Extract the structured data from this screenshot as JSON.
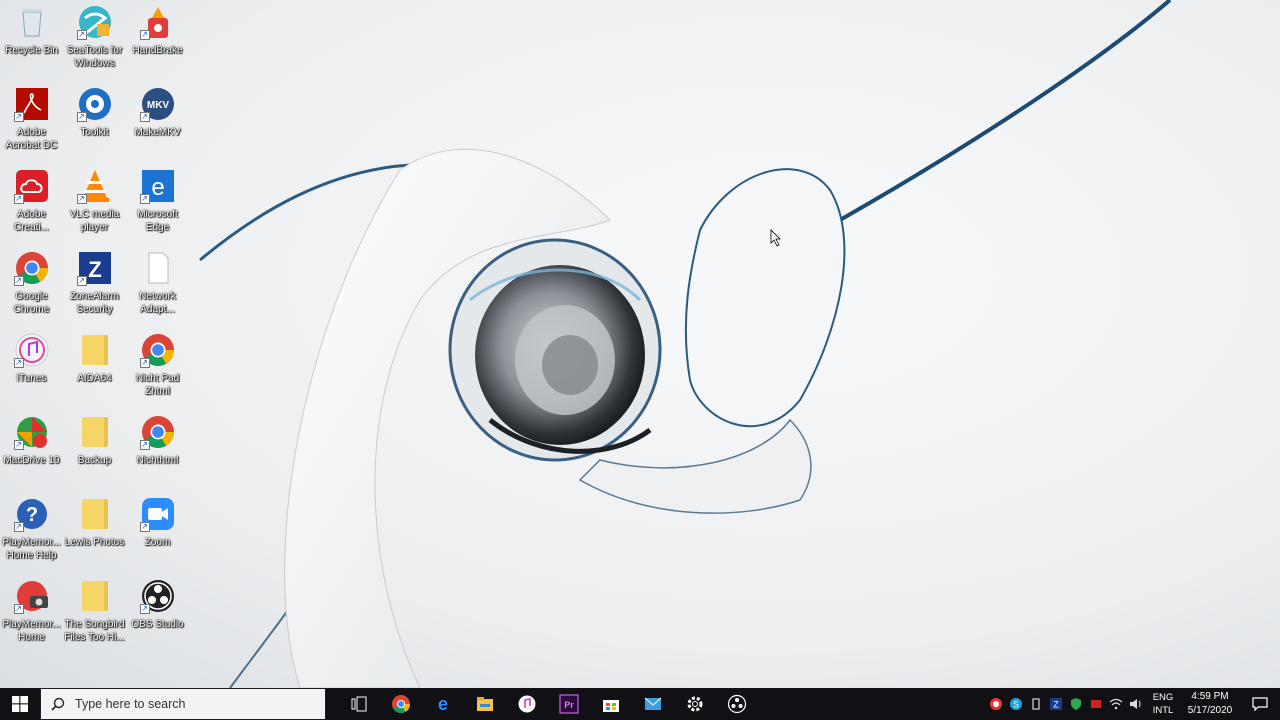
{
  "desktop": {
    "icons": [
      {
        "label": "Recycle Bin",
        "icon": "recycle-bin-icon"
      },
      {
        "label": "Adobe Acrobat DC",
        "icon": "acrobat-icon"
      },
      {
        "label": "Adobe Creati...",
        "icon": "creative-cloud-icon"
      },
      {
        "label": "Google Chrome",
        "icon": "chrome-icon"
      },
      {
        "label": "iTunes",
        "icon": "itunes-icon"
      },
      {
        "label": "MacDrive 10",
        "icon": "macdrive-icon"
      },
      {
        "label": "PlayMemor... Home Help",
        "icon": "help-icon"
      },
      {
        "label": "PlayMemor... Home",
        "icon": "playmemories-icon"
      },
      {
        "label": "SeaTools for Windows",
        "icon": "seatools-icon"
      },
      {
        "label": "Toolkit",
        "icon": "toolkit-icon"
      },
      {
        "label": "VLC media player",
        "icon": "vlc-icon"
      },
      {
        "label": "ZoneAlarm Security",
        "icon": "zonealarm-icon"
      },
      {
        "label": "AIDA64",
        "icon": "folder-icon"
      },
      {
        "label": "Backup",
        "icon": "folder-icon"
      },
      {
        "label": "Lewis Photos",
        "icon": "folder-icon"
      },
      {
        "label": "The Songbird Files Too Hi...",
        "icon": "folder-icon"
      },
      {
        "label": "HandBrake",
        "icon": "handbrake-icon"
      },
      {
        "label": "MakeMKV",
        "icon": "makemkv-icon"
      },
      {
        "label": "Microsoft Edge",
        "icon": "edge-icon"
      },
      {
        "label": "Network Adapt...",
        "icon": "file-icon"
      },
      {
        "label": "Nicht Pad Zhtml",
        "icon": "chrome-icon"
      },
      {
        "label": "Nichthtml",
        "icon": "chrome-icon"
      },
      {
        "label": "Zoom",
        "icon": "zoom-icon"
      },
      {
        "label": "OBS Studio",
        "icon": "obs-icon"
      }
    ]
  },
  "taskbar": {
    "search_placeholder": "Type here to search",
    "pinned": [
      "task-view-icon",
      "chrome-icon",
      "edge-icon",
      "file-explorer-icon",
      "itunes-icon",
      "premiere-icon",
      "store-icon",
      "mail-icon",
      "settings-icon",
      "obs-icon"
    ],
    "tray": {
      "lang_top": "ENG",
      "lang_bottom": "INTL",
      "time": "4:59 PM",
      "date": "5/17/2020"
    }
  },
  "colors": {
    "taskbar_bg": "#101015",
    "accent": "#1a57b8"
  }
}
